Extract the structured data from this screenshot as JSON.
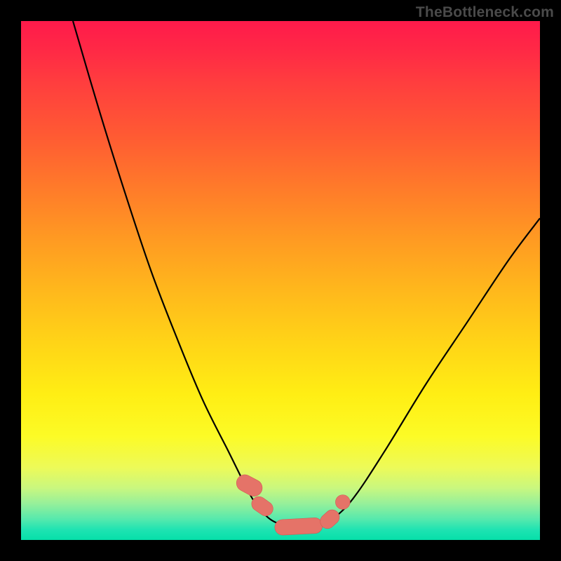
{
  "watermark": "TheBottleneck.com",
  "colors": {
    "frame": "#000000",
    "curve_stroke": "#000000",
    "marker_fill": "#e57368",
    "marker_stroke": "#d15a52",
    "gradient_top": "#ff1a4b",
    "gradient_mid": "#ffd417",
    "gradient_bottom": "#06dfa9"
  },
  "chart_data": {
    "type": "line",
    "title": "",
    "xlabel": "",
    "ylabel": "",
    "xlim": [
      0,
      100
    ],
    "ylim": [
      0,
      100
    ],
    "grid": false,
    "legend": false,
    "annotations": [],
    "series": [
      {
        "name": "left-branch",
        "x": [
          10,
          15,
          20,
          25,
          30,
          35,
          40,
          44,
          46,
          48
        ],
        "y": [
          100,
          83,
          67,
          52,
          39,
          27,
          17,
          9,
          6,
          4
        ]
      },
      {
        "name": "valley",
        "x": [
          48,
          50,
          52,
          54,
          56,
          58,
          60
        ],
        "y": [
          4,
          3,
          2.5,
          2.5,
          2.6,
          3,
          4
        ]
      },
      {
        "name": "right-branch",
        "x": [
          60,
          64,
          70,
          78,
          86,
          94,
          100
        ],
        "y": [
          4,
          8,
          17,
          30,
          42,
          54,
          62
        ]
      }
    ],
    "markers": [
      {
        "shape": "capsule",
        "cx": 44.0,
        "cy": 10.5,
        "rx": 1.6,
        "ry": 2.6,
        "angle": -62
      },
      {
        "shape": "capsule",
        "cx": 46.5,
        "cy": 6.5,
        "rx": 1.4,
        "ry": 2.2,
        "angle": -55
      },
      {
        "shape": "capsule",
        "cx": 53.5,
        "cy": 2.6,
        "rx": 4.6,
        "ry": 1.5,
        "angle": -3
      },
      {
        "shape": "capsule",
        "cx": 59.5,
        "cy": 4.0,
        "rx": 1.4,
        "ry": 2.0,
        "angle": 48
      },
      {
        "shape": "dot",
        "cx": 62.0,
        "cy": 7.3,
        "r": 1.4
      }
    ]
  }
}
